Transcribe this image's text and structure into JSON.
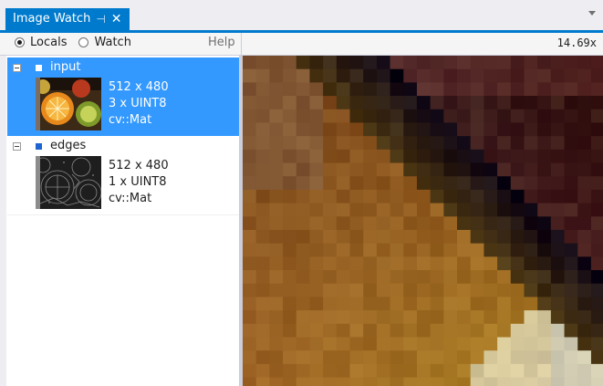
{
  "tab": {
    "title": "Image Watch",
    "pin_glyph": "⊣",
    "close_glyph": "✕"
  },
  "toolbar": {
    "radio_locals": "Locals",
    "radio_watch": "Watch",
    "selected_mode": "Locals",
    "help": "Help",
    "zoom": "14.69x"
  },
  "variables": [
    {
      "name": "input",
      "dims": "512 x 480",
      "format": "3 x UINT8",
      "type": "cv::Mat",
      "selected": true
    },
    {
      "name": "edges",
      "dims": "512 x 480",
      "format": "1 x UINT8",
      "type": "cv::Mat",
      "selected": false
    }
  ],
  "colors": {
    "accent": "#007acc",
    "selection": "#3399ff"
  },
  "image_view": {
    "content": "zoomed pixel grid of selected image"
  }
}
